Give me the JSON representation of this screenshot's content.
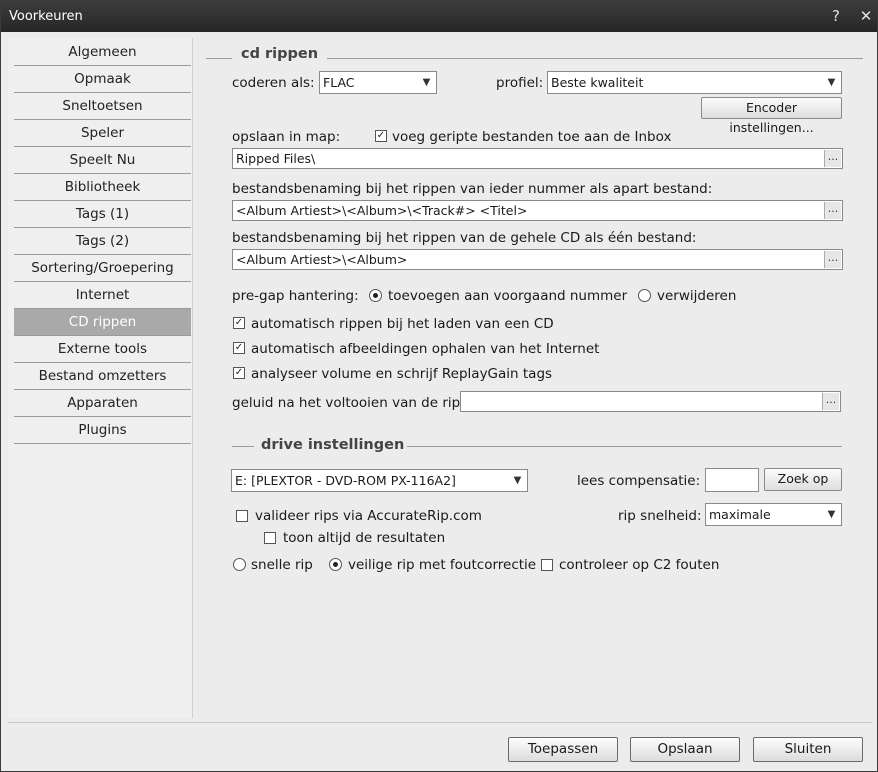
{
  "window": {
    "title": "Voorkeuren",
    "help_glyph": "?",
    "close_glyph": "✕"
  },
  "sidebar": {
    "selected": "CD rippen",
    "items": [
      {
        "label": "Algemeen"
      },
      {
        "label": "Opmaak"
      },
      {
        "label": "Sneltoetsen"
      },
      {
        "label": "Speler"
      },
      {
        "label": "Speelt Nu"
      },
      {
        "label": "Bibliotheek"
      },
      {
        "label": "Tags (1)"
      },
      {
        "label": "Tags (2)"
      },
      {
        "label": "Sortering/Groepering"
      },
      {
        "label": "Internet"
      },
      {
        "label": "CD rippen"
      },
      {
        "label": "Externe tools"
      },
      {
        "label": "Bestand omzetters"
      },
      {
        "label": "Apparaten"
      },
      {
        "label": "Plugins"
      }
    ]
  },
  "cd_section": {
    "title": "cd rippen",
    "encode_label": "coderen als:",
    "encode_value": "FLAC",
    "profile_label": "profiel:",
    "profile_value": "Beste kwaliteit",
    "encoder_button": "Encoder instellingen...",
    "save_folder_label": "opslaan in map:",
    "add_inbox_label": "voeg geripte bestanden toe aan de Inbox",
    "add_inbox_checked": true,
    "folder_value": "Ripped Files\\",
    "per_track_label": "bestandsbenaming bij het rippen van ieder nummer als apart bestand:",
    "per_track_value": "<Album Artiest>\\<Album>\\<Track#> <Titel>",
    "whole_cd_label": "bestandsbenaming bij het rippen van de gehele CD als één bestand:",
    "whole_cd_value": "<Album Artiest>\\<Album>",
    "pregap_label": "pre-gap hantering:",
    "pregap_opt1": "toevoegen aan voorgaand nummer",
    "pregap_opt2": "verwijderen",
    "pregap_selected": "toevoegen aan voorgaand nummer",
    "auto_rip_label": "automatisch rippen bij het laden van een CD",
    "auto_rip_checked": true,
    "auto_art_label": "automatisch afbeeldingen ophalen van het Internet",
    "auto_art_checked": true,
    "replaygain_label": "analyseer volume en schrijf ReplayGain tags",
    "replaygain_checked": true,
    "sound_label": "geluid na het voltooien van de rip:",
    "sound_value": "",
    "ellipsis": "..."
  },
  "drive_section": {
    "title": "drive instellingen",
    "drive_value": "E: [PLEXTOR - DVD-ROM PX-116A2]",
    "read_comp_label": "lees compensatie:",
    "read_comp_value": "",
    "lookup_button": "Zoek op",
    "accuraterip_label": "valideer rips via AccurateRip.com",
    "accuraterip_checked": false,
    "show_results_label": "toon altijd de resultaten",
    "show_results_checked": false,
    "rip_speed_label": "rip snelheid:",
    "rip_speed_value": "maximale",
    "fast_rip_label": "snelle rip",
    "secure_rip_label": "veilige rip met foutcorrectie",
    "rip_mode_selected": "veilige rip met foutcorrectie",
    "c2_label": "controleer op C2 fouten",
    "c2_checked": false
  },
  "footer": {
    "apply": "Toepassen",
    "save": "Opslaan",
    "close": "Sluiten"
  },
  "colors": {
    "title_bar": "#2d2d2d",
    "selected_item": "#a9a9a9",
    "panel": "#ececec"
  },
  "icons": {
    "dropdown": "triangle-down-icon",
    "check": "check-icon",
    "help": "question-icon",
    "close": "close-icon"
  }
}
